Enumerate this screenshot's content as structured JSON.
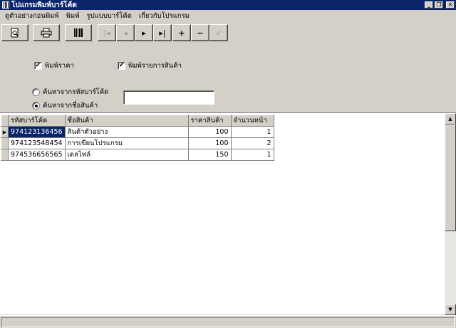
{
  "window": {
    "title": "โปแกรมพิมพ์บาร์โค้ด"
  },
  "menu": [
    "ดูตัวอย่างก่อนพิมพ์",
    "พิมพ์",
    "รูปแบบบาร์โค้ด",
    "เกี่ยวกับโปรแกรม"
  ],
  "options": {
    "print_price_label": "พิมพ์ราคา",
    "print_price_checked": true,
    "print_items_label": "พิมพ์รายการสินค้า",
    "print_items_checked": true
  },
  "search": {
    "by_barcode_label": "ค้นหาจากรหัสบาร์โค้ด",
    "by_name_label": "ค้นหาจากชื่อสินค้า",
    "selected": "by_name",
    "value": ""
  },
  "table": {
    "columns": [
      "รหัสบาร์โค้ด",
      "ชื่อสินค้า",
      "ราคาสินค้า",
      "จำนวนหน้า"
    ],
    "rows": [
      [
        "974123136456",
        "สินค้าตัวอย่าง",
        "100",
        "1"
      ],
      [
        "974123548454",
        "การเขียนโปรแกรม",
        "100",
        "2"
      ],
      [
        "974536656565",
        "เดลไฟล์",
        "150",
        "1"
      ]
    ],
    "current_row": 0
  }
}
